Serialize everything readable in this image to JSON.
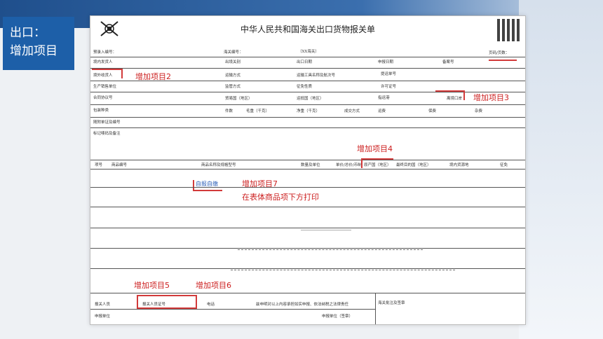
{
  "slide": {
    "title_line1": "出口：",
    "title_line2": "增加项目"
  },
  "form": {
    "title": "中华人民共和国海关出口货物报关单",
    "pre_entry_no": "预录入编号：",
    "customs_no": "海关编号：",
    "customs_code": "（XX海关）",
    "page_no": "页码/页数：",
    "domestic_consignor": "境内发货人",
    "exit_customs": "出境关别",
    "export_date": "出口日期",
    "declare_date": "申报日期",
    "record_no": "备案号",
    "overseas_consignee": "境外收货人",
    "transport_mode": "运输方式",
    "transport_name": "运输工具名称及航次号",
    "bill_no": "提运单号",
    "producer": "生产销售单位",
    "supervision_mode": "监管方式",
    "tax_nature": "征免性质",
    "license_no": "许可证号",
    "contract_no": "合同协议号",
    "trade_country": "贸易国（地区）",
    "destination_country": "运抵国（地区）",
    "departure_port": "指运港",
    "exit_port": "离境口岸",
    "package_type": "包装种类",
    "pieces": "件数",
    "gross_weight": "毛重（千克）",
    "net_weight": "净重（千克）",
    "deal_mode": "成交方式",
    "freight": "运费",
    "insurance": "保费",
    "misc_fee": "杂费",
    "attached_docs": "随附单证及编号",
    "marks_remarks": "标记唛码及备注",
    "col_item": "项号",
    "col_code": "商品编号",
    "col_name": "商品名称及规格型号",
    "col_qty": "数量及单位",
    "col_price": "单价/总价/币制",
    "col_origin": "原产国（地区）",
    "col_final_dest": "最终目的国（地区）",
    "col_source": "境内货源地",
    "col_exempt": "征免",
    "self_declare": "自报自缴",
    "declarant": "报关人员",
    "declarant_cert": "报关人员证号",
    "phone": "电话",
    "statement": "兹申明对以上内容承担如实申报、依法纳税之法律责任",
    "customs_approval": "海关批注及签章",
    "declaring_unit": "申报单位",
    "declaring_unit_sign": "申报单位（签章）"
  },
  "annotations": {
    "item2": "增加项目2",
    "item3": "增加项目3",
    "item4": "增加项目4",
    "item5": "增加项目5",
    "item6": "增加项目6",
    "item7": "增加项目7",
    "item7_note": "在表体商品项下方打印"
  },
  "colors": {
    "accent_blue": "#1d5fa8",
    "annotation_red": "#cc1f1f"
  }
}
